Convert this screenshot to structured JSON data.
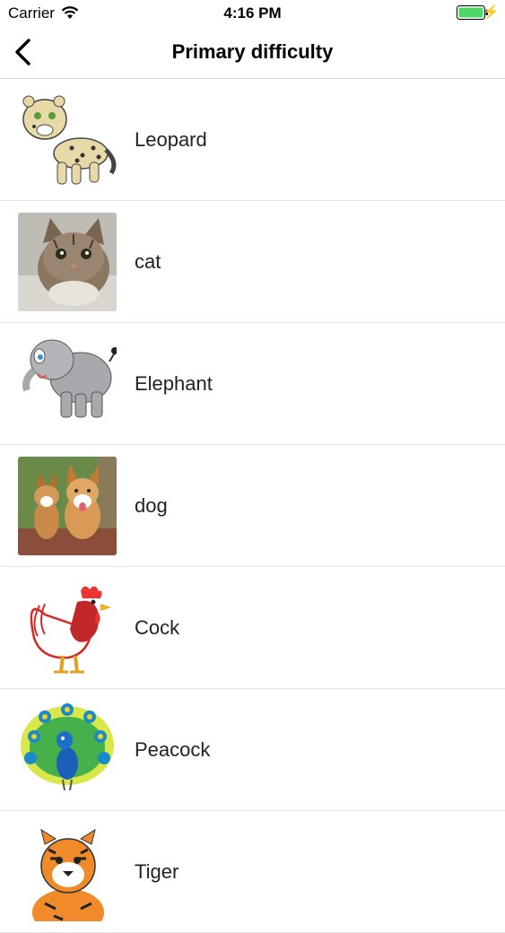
{
  "status": {
    "carrier": "Carrier",
    "time": "4:16 PM"
  },
  "nav": {
    "title": "Primary difficulty",
    "back_icon": "chevron-left-icon"
  },
  "items": [
    {
      "label": "Leopard",
      "image": "leopard-cartoon"
    },
    {
      "label": "cat",
      "image": "kitten-photo"
    },
    {
      "label": "Elephant",
      "image": "elephant-cartoon"
    },
    {
      "label": "dog",
      "image": "corgi-dogs-photo"
    },
    {
      "label": "Cock",
      "image": "rooster-cartoon"
    },
    {
      "label": "Peacock",
      "image": "peacock-cartoon"
    },
    {
      "label": "Tiger",
      "image": "tiger-cartoon"
    }
  ],
  "colors": {
    "battery": "#4cd964",
    "divider": "#e4e4e4"
  }
}
